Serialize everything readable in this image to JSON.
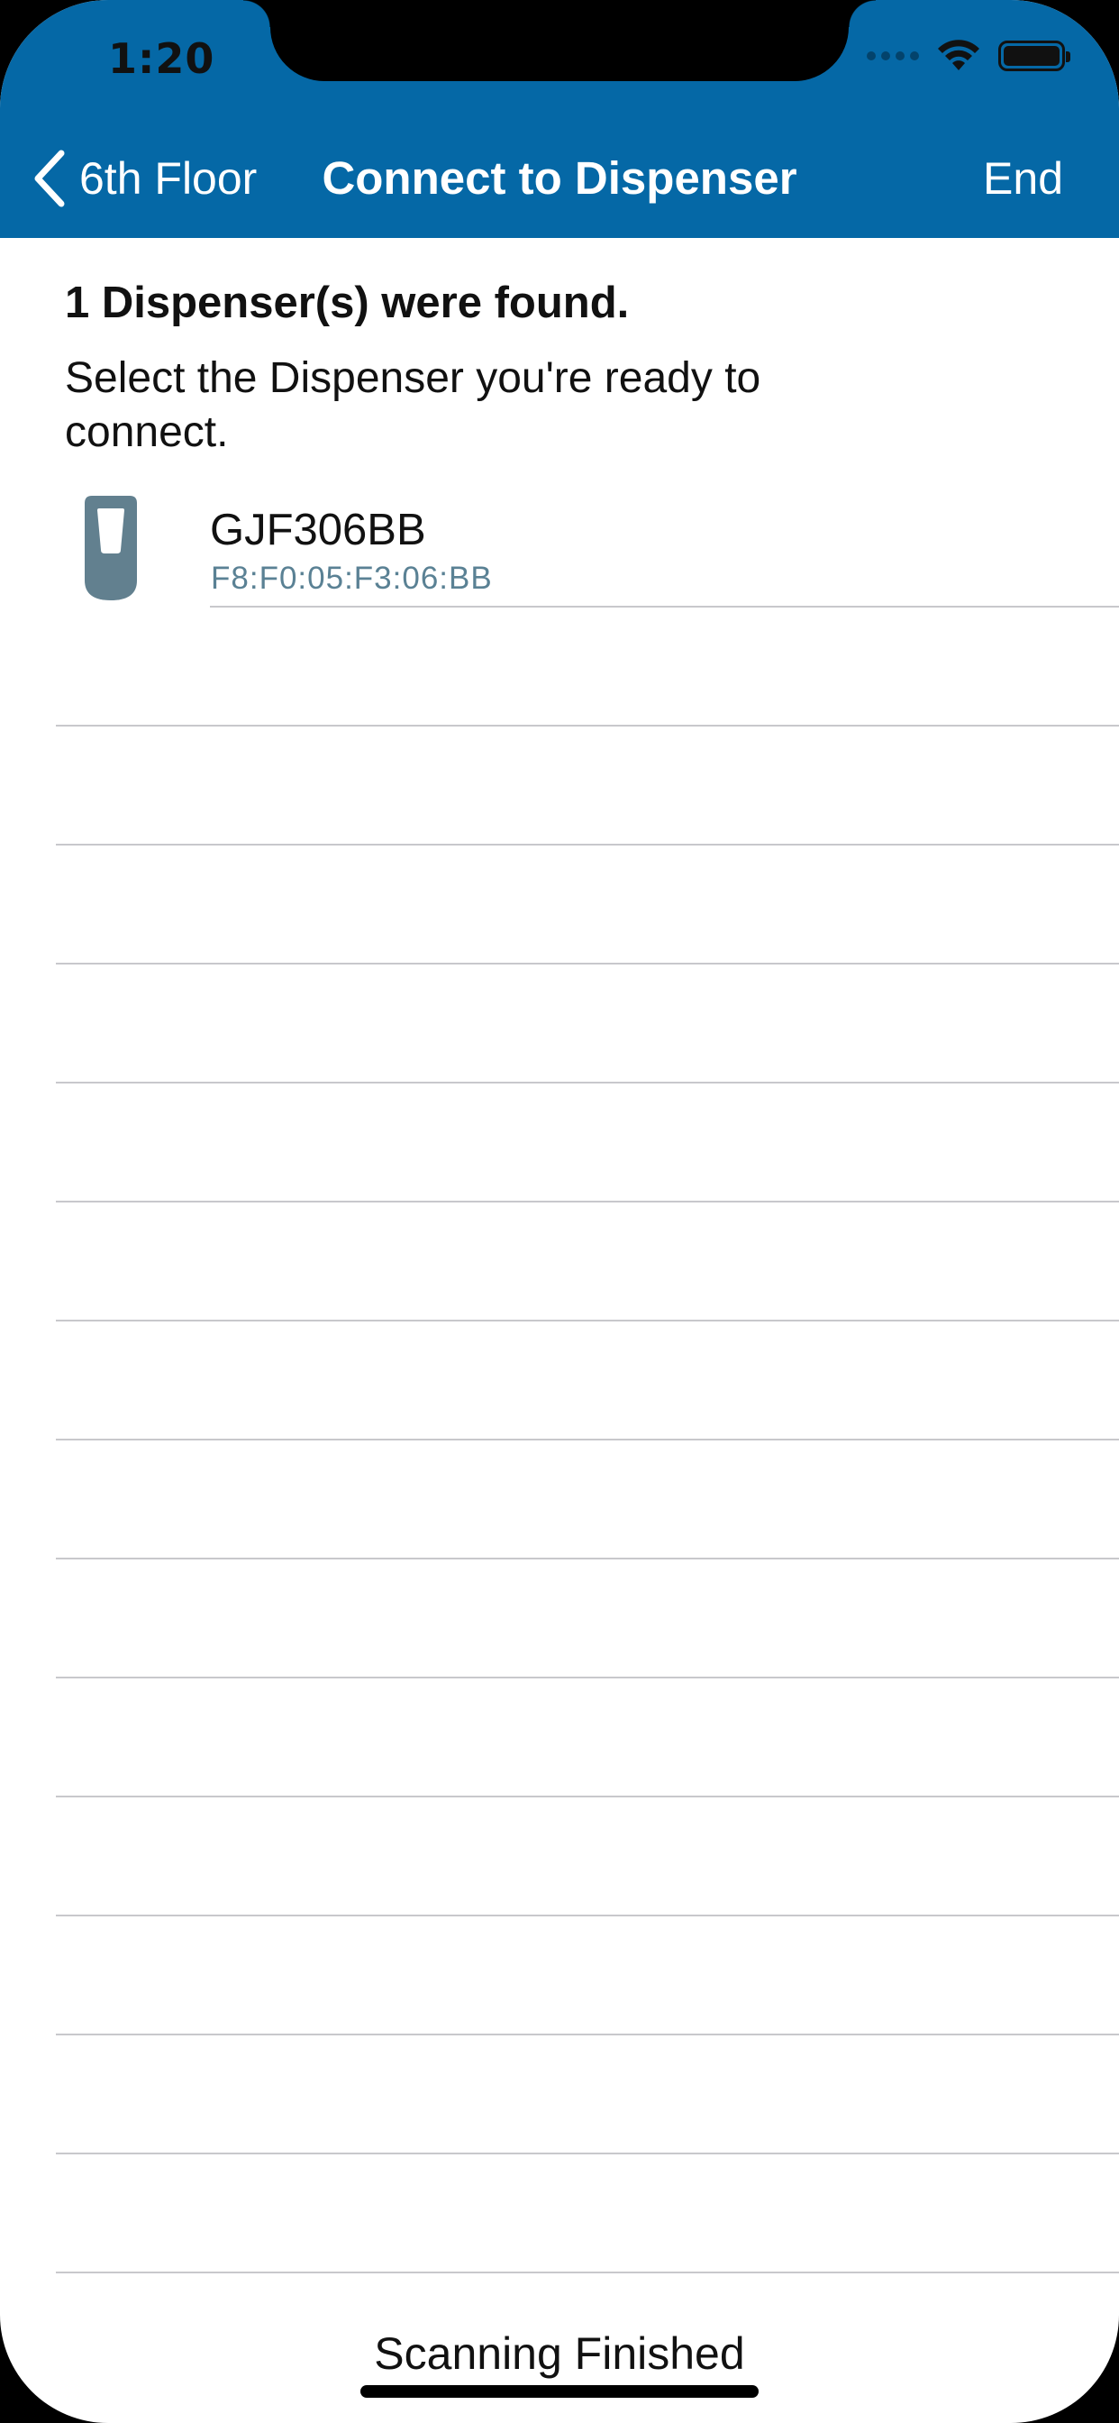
{
  "status_bar": {
    "time": "1:20",
    "icons": [
      "signal-icon",
      "wifi-icon",
      "battery-icon"
    ]
  },
  "nav": {
    "back_label": "6th Floor",
    "title": "Connect to Dispenser",
    "right_action": "End"
  },
  "content": {
    "found_title": "1 Dispenser(s) were found.",
    "instruction": "Select the Dispenser you're ready to connect."
  },
  "devices": [
    {
      "name": "GJF306BB",
      "mac": "F8:F0:05:F3:06:BB",
      "icon": "dispenser-icon"
    }
  ],
  "footer": {
    "status": "Scanning Finished"
  },
  "colors": {
    "header_blue": "#0568a6",
    "mac_text": "#5a8194",
    "dispenser_icon": "#62808f",
    "separator": "#c8c8cc"
  }
}
